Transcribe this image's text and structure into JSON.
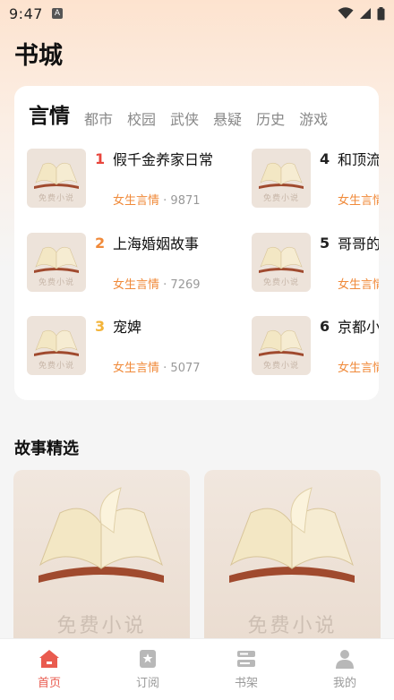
{
  "status": {
    "time": "9:47",
    "notification": "A"
  },
  "page_title": "书城",
  "tabs": [
    {
      "label": "言情",
      "active": true
    },
    {
      "label": "都市"
    },
    {
      "label": "校园"
    },
    {
      "label": "武侠"
    },
    {
      "label": "悬疑"
    },
    {
      "label": "历史"
    },
    {
      "label": "游戏"
    }
  ],
  "cover_watermark": "免费小说",
  "rank_items": [
    {
      "rank": "1",
      "title": "假千金养家日常",
      "genre": "女生言情",
      "count": "· 9871",
      "rank_color": "#e8453c"
    },
    {
      "rank": "2",
      "title": "上海婚姻故事",
      "genre": "女生言情",
      "count": "· 7269",
      "rank_color": "#f08a3a"
    },
    {
      "rank": "3",
      "title": "宠婢",
      "genre": "女生言情",
      "count": "· 5077",
      "rank_color": "#f3b43a"
    },
    {
      "rank": "4",
      "title": "和顶流前任的回忆了",
      "genre": "女生言情",
      "count": "",
      "rank_color": "#222222"
    },
    {
      "rank": "5",
      "title": "哥哥的",
      "genre": "女生言情",
      "count": "",
      "rank_color": "#222222"
    },
    {
      "rank": "6",
      "title": "京都小",
      "genre": "女生言情",
      "count": "",
      "rank_color": "#222222"
    }
  ],
  "section_title": "故事精选",
  "story_watermark": "免费小说",
  "nav": [
    {
      "label": "首页",
      "icon": "home-icon",
      "active": true
    },
    {
      "label": "订阅",
      "icon": "bookmark-icon"
    },
    {
      "label": "书架",
      "icon": "bookshelf-icon"
    },
    {
      "label": "我的",
      "icon": "user-icon"
    }
  ],
  "colors": {
    "accent": "#e95b4f",
    "genre": "#f08a3a"
  }
}
